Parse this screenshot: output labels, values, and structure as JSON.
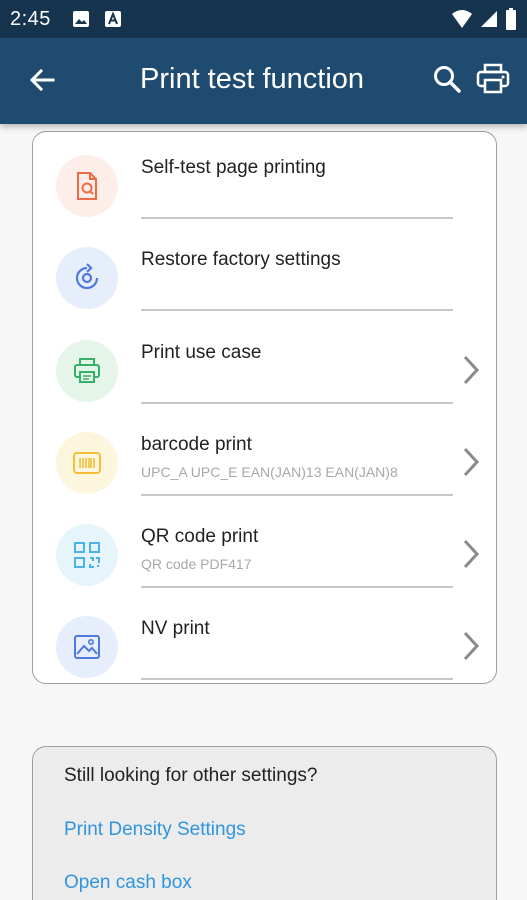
{
  "status_bar": {
    "time": "2:45",
    "icons": [
      "image-notification-icon",
      "a-notification-icon",
      "wifi-icon",
      "cell-signal-icon",
      "battery-icon"
    ]
  },
  "app_bar": {
    "title": "Print test function",
    "back_icon": "arrow-left-icon",
    "search_icon": "search-icon",
    "printer_icon": "printer-icon",
    "background": "#204b70",
    "status_background": "#17344f"
  },
  "menu": {
    "items": [
      {
        "title": "Self-test page printing",
        "subtitle": "",
        "icon": "document-search-icon",
        "icon_color": "#ee6b46",
        "icon_bg": "#fdeee9",
        "has_chevron": false
      },
      {
        "title": "Restore factory settings",
        "subtitle": "",
        "icon": "restore-icon",
        "icon_color": "#4f79de",
        "icon_bg": "#e7eefb",
        "has_chevron": false
      },
      {
        "title": "Print use case",
        "subtitle": "",
        "icon": "printer-icon",
        "icon_color": "#37b067",
        "icon_bg": "#e6f5ea",
        "has_chevron": true
      },
      {
        "title": "barcode print",
        "subtitle": "UPC_A UPC_E EAN(JAN)13 EAN(JAN)8",
        "icon": "barcode-icon",
        "icon_color": "#f1c034",
        "icon_bg": "#fdf6df",
        "has_chevron": true
      },
      {
        "title": "QR code print",
        "subtitle": "QR code PDF417",
        "icon": "qr-code-icon",
        "icon_color": "#4bb3e8",
        "icon_bg": "#e6f4fb",
        "has_chevron": true
      },
      {
        "title": "NV print",
        "subtitle": "",
        "icon": "image-icon",
        "icon_color": "#4f79de",
        "icon_bg": "#e7eefb",
        "has_chevron": true
      }
    ]
  },
  "settings": {
    "question": "Still looking for other settings?",
    "links": [
      "Print Density Settings",
      "Open cash box"
    ],
    "link_color": "#2f95e0"
  }
}
